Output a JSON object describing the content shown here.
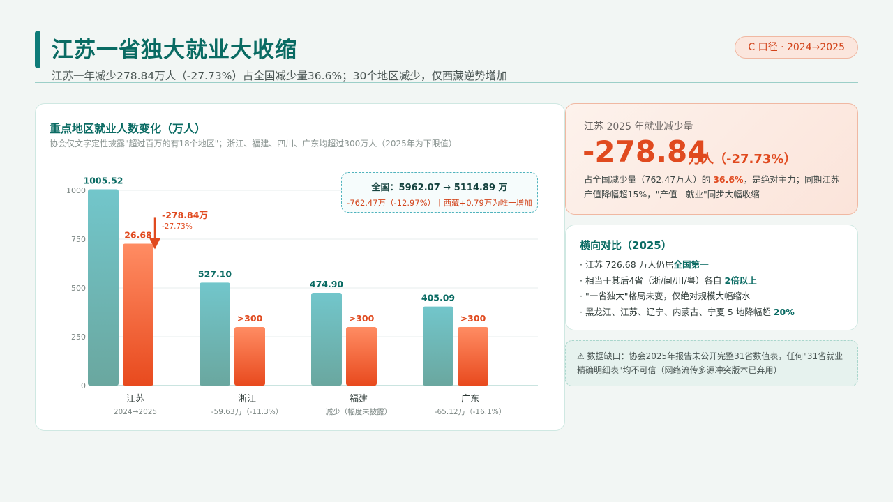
{
  "header": {
    "title": "江苏一省独大就业大收缩",
    "subtitle": "江苏一年减少278.84万人（-27.73%）占全国减少量36.6%；30个地区减少，仅西藏逆势增加",
    "badge": "C 口径 · 2024→2025"
  },
  "chart": {
    "title": "重点地区就业人数变化（万人）",
    "subtitle": "协会仅文字定性披露\"超过百万的有18个地区\"；浙江、福建、四川、广东均超过300万人（2025年为下限值）",
    "national": {
      "line1": "全国：5962.07 → 5114.89 万",
      "line2": "-762.47万（-12.97%）｜西藏+0.79万为唯一增加"
    },
    "jiangsu_annotation": {
      "change": "-278.84万",
      "pct": "-27.73%"
    }
  },
  "chart_data": {
    "type": "bar",
    "categories": [
      "江苏",
      "浙江",
      "福建",
      "广东"
    ],
    "category_notes": [
      "2024→2025",
      "-59.63万（-11.3%）",
      "减少（幅度未披露）",
      "-65.12万（-16.1%）"
    ],
    "series": [
      {
        "values": [
          1005.52,
          527.1,
          474.9,
          405.09
        ],
        "labels": [
          "1005.52",
          "527.10",
          "474.90",
          "405.09"
        ],
        "color": "#6cc1c6"
      },
      {
        "values": [
          726.68,
          300,
          300,
          300
        ],
        "labels": [
          "726.68",
          ">300",
          ">300",
          ">300"
        ],
        "color": "#ee5a2c"
      }
    ],
    "y_ticks": [
      0,
      250,
      500,
      750,
      1000
    ],
    "ylim": [
      0,
      1100
    ],
    "grid": true
  },
  "kpi": {
    "label": "江苏 2025 年就业减少量",
    "value": "-278.84",
    "unit": "万人（-27.73%）",
    "desc_1": "占全国减少量（762.47万人）的 ",
    "desc_highlight": "36.6%",
    "desc_2": "，是绝对主力；同期江苏产值降幅超15%，\"产值—就业\"同步大幅收缩"
  },
  "comparison": {
    "title": "横向对比（2025）",
    "item1_a": "· 江苏 726.68 万人仍居",
    "item1_b": "全国第一",
    "item2_a": "· 相当于其后4省（浙/闽/川/粤）各自 ",
    "item2_b": "2倍以上",
    "item3": "· \"一省独大\"格局未变，仅绝对规模大幅缩水",
    "item4_a": "· 黑龙江、江苏、辽宁、内蒙古、宁夏 5 地降幅超 ",
    "item4_b": "20%"
  },
  "note": {
    "text": "⚠ 数据缺口：协会2025年报告未公开完整31省数值表，任何\"31省就业精确明细表\"均不可信（网络流传多源冲突版本已弃用）"
  },
  "colors": {
    "teal": "#0a6b63",
    "accent": "#e04a1f"
  }
}
